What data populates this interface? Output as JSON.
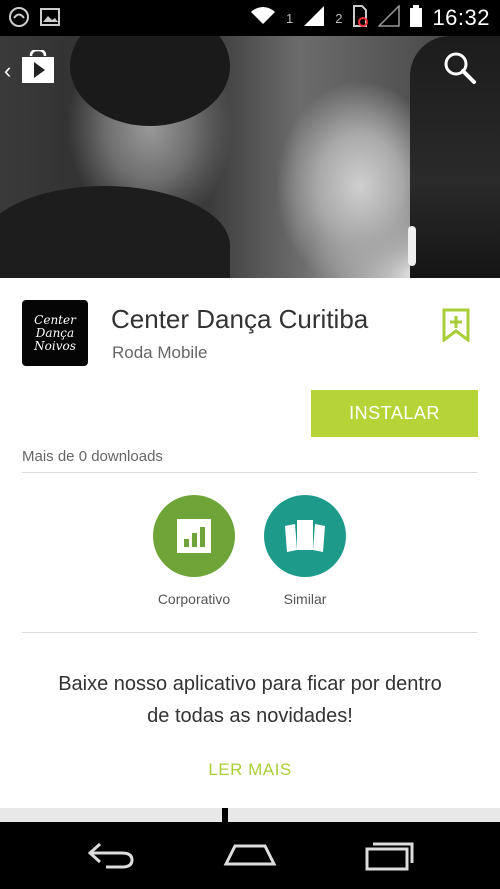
{
  "status_bar": {
    "sim1_label": "1",
    "sim2_label": "2",
    "time": "16:32"
  },
  "toolbar": {
    "back_glyph": "‹",
    "store_icon": "play-store-icon",
    "search_icon": "search-icon"
  },
  "app": {
    "icon_text": [
      "Center",
      "Dança",
      "Noivos"
    ],
    "title": "Center Dança Curitiba",
    "developer": "Roda Mobile",
    "install_label": "INSTALAR",
    "downloads": "Mais de 0 downloads",
    "actions": [
      {
        "label": "Corporativo",
        "icon": "bar-chart-icon",
        "color": "#6fa538"
      },
      {
        "label": "Similar",
        "icon": "cards-icon",
        "color": "#1e9a8a"
      }
    ],
    "description_line1": "Baixe nosso aplicativo para ficar por dentro",
    "description_line2": "de todas as novidades!",
    "read_more_label": "LER MAIS"
  },
  "colors": {
    "accent": "#b6d437",
    "read_more": "#a9cf38"
  }
}
